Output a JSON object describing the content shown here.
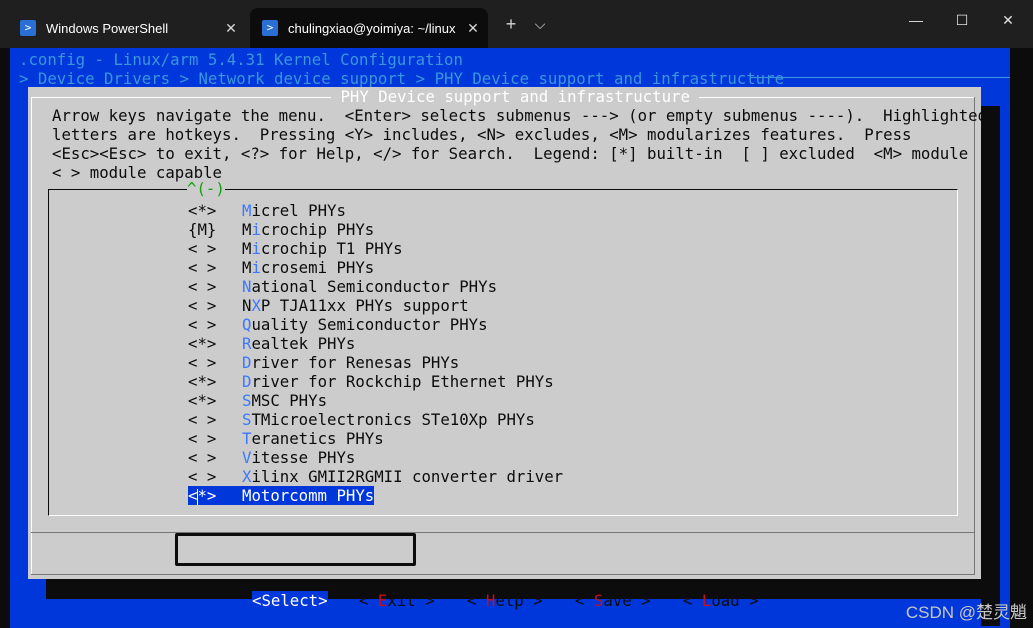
{
  "tabs": [
    {
      "label": "Windows PowerShell",
      "active": false
    },
    {
      "label": "chulingxiao@yoimiya: ~/linux",
      "active": true
    }
  ],
  "tab_bar": {
    "new_tab": "+",
    "dropdown": "⌵"
  },
  "window_controls": {
    "minimize": "—",
    "maximize": "☐",
    "close": "✕"
  },
  "header": {
    "config_line": ".config - Linux/arm 5.4.31 Kernel Configuration",
    "breadcrumb": "> Device Drivers > Network device support > PHY Device support and infrastructure "
  },
  "dialog": {
    "title": " PHY Device support and infrastructure ",
    "help_lines": [
      "Arrow keys navigate the menu.  <Enter> selects submenus ---> (or empty submenus ----).  Highlighted",
      "letters are hotkeys.  Pressing <Y> includes, <N> excludes, <M> modularizes features.  Press",
      "<Esc><Esc> to exit, <?> for Help, </> for Search.  Legend: [*] built-in  [ ] excluded  <M> module",
      "< > module capable"
    ],
    "scroll_indicator": "^(-)",
    "items": [
      {
        "mark": "<*>",
        "hotkey": "M",
        "rest": "icrel PHYs"
      },
      {
        "mark": "{M}",
        "pre": "M",
        "hotkey": "i",
        "rest": "crochip PHYs"
      },
      {
        "mark": "< >",
        "pre": "M",
        "hotkey": "i",
        "rest": "crochip T1 PHYs"
      },
      {
        "mark": "< >",
        "pre": "M",
        "hotkey": "i",
        "rest": "crosemi PHYs"
      },
      {
        "mark": "< >",
        "hotkey": "N",
        "rest": "ational Semiconductor PHYs"
      },
      {
        "mark": "< >",
        "pre": "N",
        "hotkey": "X",
        "rest": "P TJA11xx PHYs support"
      },
      {
        "mark": "< >",
        "hotkey": "Q",
        "rest": "uality Semiconductor PHYs"
      },
      {
        "mark": "<*>",
        "hotkey": "R",
        "rest": "ealtek PHYs"
      },
      {
        "mark": "< >",
        "hotkey": "D",
        "rest": "river for Renesas PHYs"
      },
      {
        "mark": "<*>",
        "hotkey": "D",
        "rest": "river for Rockchip Ethernet PHYs"
      },
      {
        "mark": "<*>",
        "hotkey": "S",
        "rest": "MSC PHYs"
      },
      {
        "mark": "< >",
        "hotkey": "S",
        "rest": "TMicroelectronics STe10Xp PHYs"
      },
      {
        "mark": "< >",
        "hotkey": "T",
        "rest": "eranetics PHYs"
      },
      {
        "mark": "< >",
        "hotkey": "V",
        "rest": "itesse PHYs"
      },
      {
        "mark": "< >",
        "hotkey": "X",
        "rest": "ilinx GMII2RGMII converter driver"
      },
      {
        "mark": "<*>",
        "hotkey": "",
        "rest": "Motorcomm PHYs",
        "selected": true
      }
    ],
    "buttons": [
      {
        "pre": "<",
        "hotkey": "S",
        "rest": "elect>",
        "selected": true
      },
      {
        "pre": "< ",
        "hotkey": "E",
        "rest": "xit >"
      },
      {
        "pre": "< ",
        "hotkey": "H",
        "rest": "elp >"
      },
      {
        "pre": "< ",
        "hotkey": "S",
        "rest": "ave >"
      },
      {
        "pre": "< ",
        "hotkey": "L",
        "rest": "oad >"
      }
    ]
  },
  "watermark": "CSDN @楚灵魈",
  "colors": {
    "terminal_bg": "#0037da",
    "dialog_bg": "#cccccc",
    "hotkey_blue": "#3b78ff",
    "button_hotkey_red": "#c50f1f",
    "scroll_green": "#13a10e"
  }
}
